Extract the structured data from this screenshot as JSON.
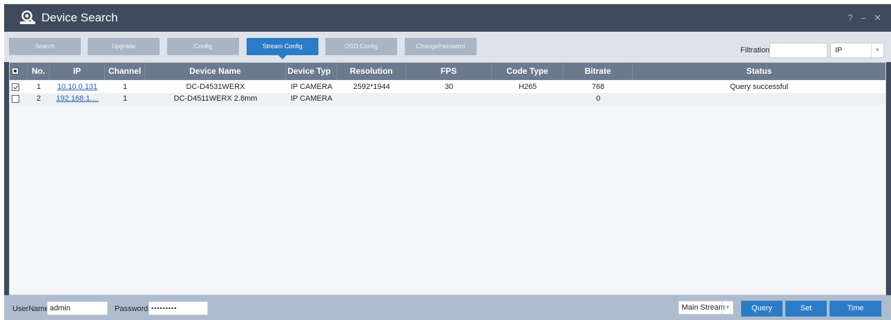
{
  "window": {
    "title": "Device Search",
    "controls": [
      "?",
      "–",
      "✕"
    ]
  },
  "toolbar": {
    "buttons": [
      "Search",
      "Upgrade",
      "Config",
      "Stream Config",
      "OSD Config",
      "ChangePassword"
    ],
    "active": "Stream Config",
    "filtration_label": "Filtration",
    "filtration_value": "",
    "filter_type": "IP"
  },
  "table": {
    "columns": [
      "",
      "No.",
      "IP",
      "Channel",
      "Device Name",
      "Device Typ",
      "Resolution",
      "FPS",
      "Code Type",
      "Bitrate",
      "Status"
    ],
    "rows": [
      {
        "checked": true,
        "no": "1",
        "ip": "10.10.0.131",
        "channel": "1",
        "device_name": "DC-D4531WERX",
        "device_type": "IP CAMERA",
        "resolution": "2592*1944",
        "fps": "30",
        "code_type": "H265",
        "bitrate": "768",
        "status": "Query successful"
      },
      {
        "checked": false,
        "no": "2",
        "ip": "192.168.1....",
        "channel": "1",
        "device_name": "DC-D4511WERX 2.8mm",
        "device_type": "IP CAMERA",
        "resolution": "",
        "fps": "",
        "code_type": "",
        "bitrate": "0",
        "status": ""
      }
    ]
  },
  "footer": {
    "username_label": "UserName",
    "username_value": "admin",
    "password_label": "Password",
    "password_value": "•••••••••",
    "stream_select": "Main Stream",
    "query_label": "Query",
    "set_label": "Set",
    "time_correction_label": "Time Correction"
  },
  "colors": {
    "titlebar": "#3f4b5d",
    "accent": "#2b7cc6",
    "header": "#6c7a8f",
    "link": "#1f5fb3"
  }
}
